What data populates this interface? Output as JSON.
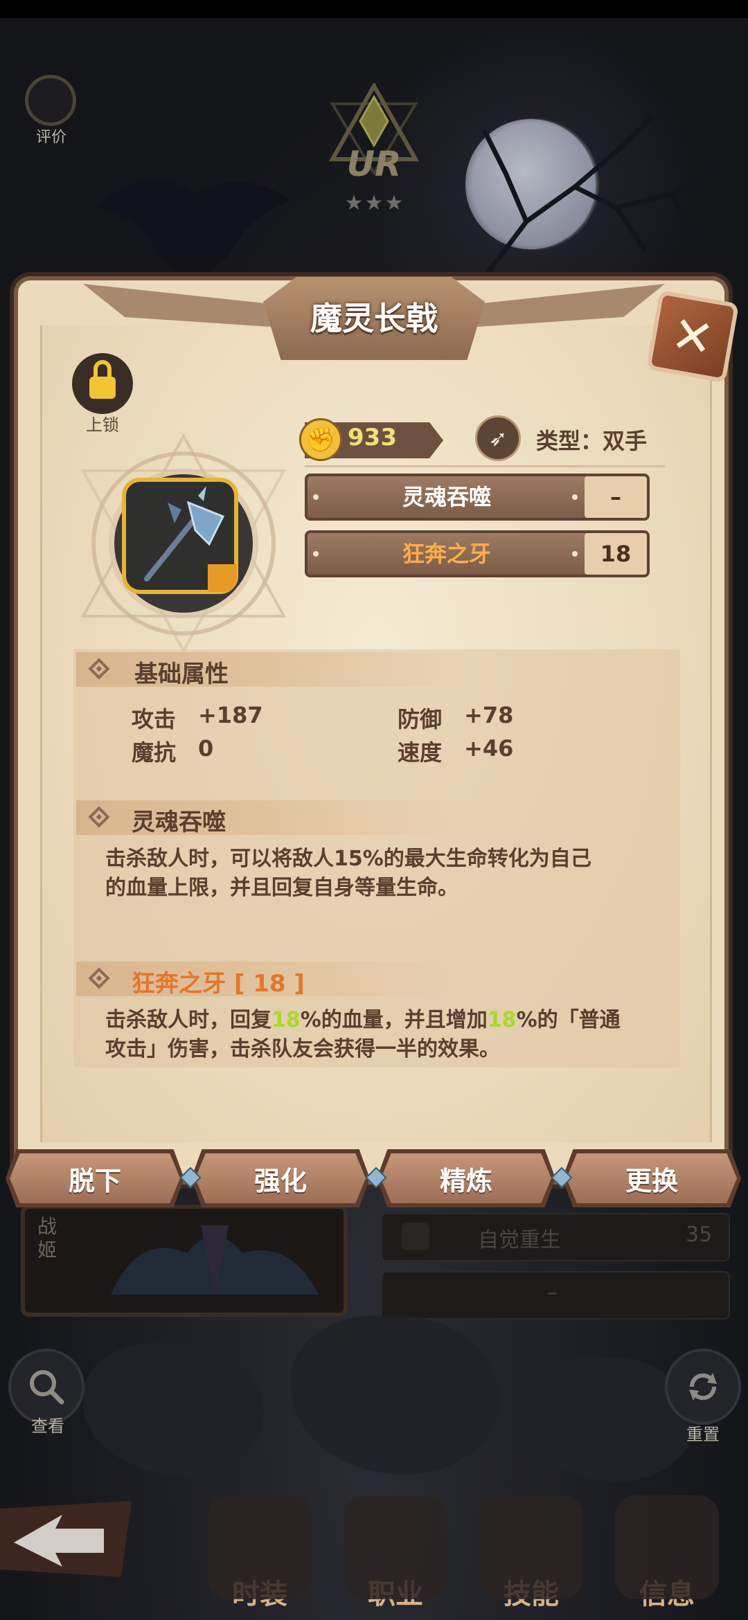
{
  "background": {
    "rate_label": "评价",
    "rarity": "UR",
    "stars": "★★★",
    "hero_tag": "战姬",
    "rebirth_label": "自觉重生",
    "rebirth_value": "35",
    "empty_slot": "–",
    "search_label": "查看",
    "reset_label": "重置",
    "nav": [
      {
        "label": "时装"
      },
      {
        "label": "职业"
      },
      {
        "label": "技能"
      },
      {
        "label": "信息"
      }
    ]
  },
  "dialog": {
    "title": "魔灵长戟",
    "lock_label": "上锁",
    "power": "933",
    "type_label": "类型：双手",
    "skills": [
      {
        "name": "灵魂吞噬",
        "value": "–"
      },
      {
        "name": "狂奔之牙",
        "value": "18"
      }
    ],
    "base_section": {
      "title": "基础属性",
      "stats": [
        {
          "label": "攻击",
          "value": "+187"
        },
        {
          "label": "防御",
          "value": "+78"
        },
        {
          "label": "魔抗",
          "value": "0"
        },
        {
          "label": "速度",
          "value": "+46"
        }
      ]
    },
    "soul_section": {
      "title": "灵魂吞噬",
      "desc_line1": "击杀敌人时，可以将敌人15%的最大生命转化为自己",
      "desc_line2": "的血量上限，并且回复自身等量生命。"
    },
    "fang_section": {
      "title": "狂奔之牙 [ 18 ]",
      "desc_a": "击杀敌人时，回复",
      "desc_hl1": "18",
      "desc_b": "%的血量，并且增加",
      "desc_hl2": "18",
      "desc_c": "%的「普通",
      "desc_line2": "攻击」伤害，击杀队友会获得一半的效果。"
    },
    "actions": [
      {
        "label": "脱下"
      },
      {
        "label": "强化"
      },
      {
        "label": "精炼"
      },
      {
        "label": "更换"
      }
    ]
  },
  "colors": {
    "parchment": "#ebdbbc",
    "frame": "#7a5a44",
    "highlight_green": "#a9d92c",
    "orange_text": "#e4762a",
    "gold": "#f2c532"
  }
}
